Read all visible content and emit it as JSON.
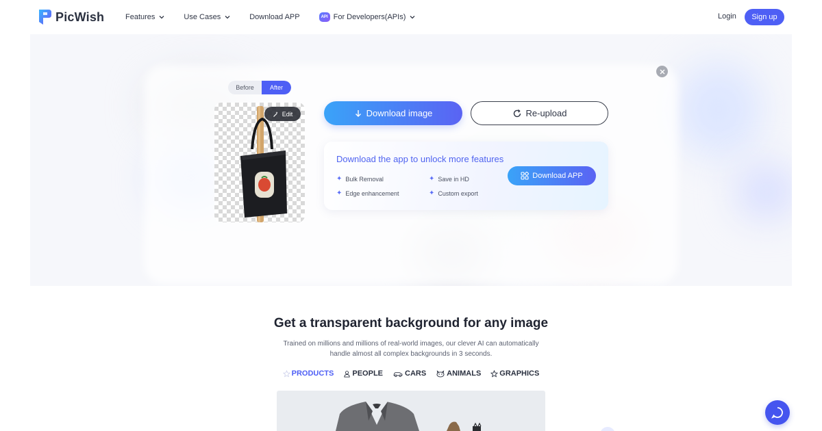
{
  "brand": {
    "name": "PicWish",
    "logo_icon": "picwish-logo-icon",
    "accent": "#4e5ff5"
  },
  "nav": {
    "items": [
      {
        "label": "Features",
        "has_dropdown": true
      },
      {
        "label": "Use Cases",
        "has_dropdown": true
      },
      {
        "label": "Download APP",
        "has_dropdown": false
      },
      {
        "label": "For Developers(APIs)",
        "has_dropdown": true,
        "badge": "API"
      }
    ],
    "login": "Login",
    "signup": "Sign up"
  },
  "editor": {
    "toggle": {
      "before": "Before",
      "after": "After",
      "selected": "After"
    },
    "edit_label": "Edit",
    "download_image": "Download image",
    "reupload": "Re-upload",
    "app_promo": {
      "title": "Download the app to unlock more features",
      "features": [
        "Bulk Removal",
        "Save in HD",
        "Edge enhancement",
        "Custom export"
      ],
      "button": "Download APP"
    }
  },
  "section": {
    "title": "Get a transparent background for any image",
    "description": "Trained on millions and millions of real-world images, our clever AI can automatically handle almost all complex backgrounds in 3 seconds.",
    "tabs": [
      {
        "label": "PRODUCTS",
        "icon": "star-outline-icon",
        "active": true
      },
      {
        "label": "PEOPLE",
        "icon": "person-icon",
        "active": false
      },
      {
        "label": "CARS",
        "icon": "car-icon",
        "active": false
      },
      {
        "label": "ANIMALS",
        "icon": "animal-icon",
        "active": false
      },
      {
        "label": "GRAPHICS",
        "icon": "star-icon",
        "active": false
      }
    ]
  }
}
